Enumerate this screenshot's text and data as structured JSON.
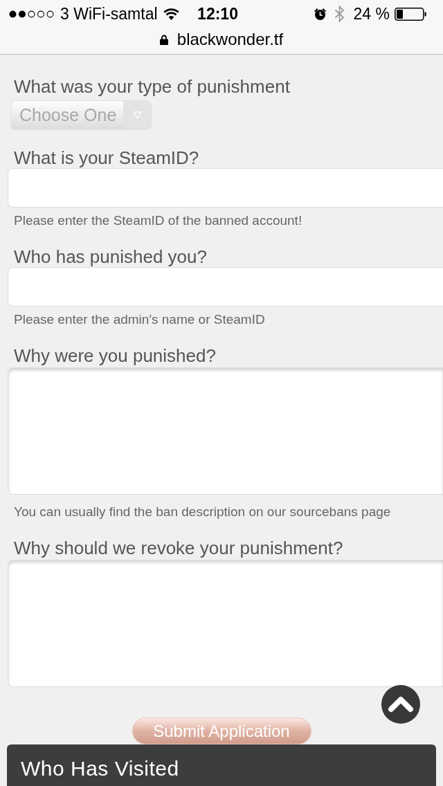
{
  "status_bar": {
    "carrier": "3 WiFi-samtal",
    "time": "12:10",
    "battery": "24 %"
  },
  "address_bar": {
    "url": "blackwonder.tf"
  },
  "form": {
    "fields": [
      {
        "kind": "select",
        "label": "What was your type of punishment",
        "value": "Choose One"
      },
      {
        "kind": "text",
        "label": "What is your SteamID?",
        "help": "Please enter the SteamID of the banned account!"
      },
      {
        "kind": "text",
        "label": "Who has punished you?",
        "help": "Please enter the admin's name or SteamID"
      },
      {
        "kind": "textarea",
        "label": "Why were you punished?",
        "help": "You can usually find the ban description on our sourcebans page"
      },
      {
        "kind": "textarea",
        "label": "Why should we revoke your punishment?"
      }
    ],
    "submit": "Submit Application"
  },
  "panel": {
    "title": "Who Has Visited"
  }
}
